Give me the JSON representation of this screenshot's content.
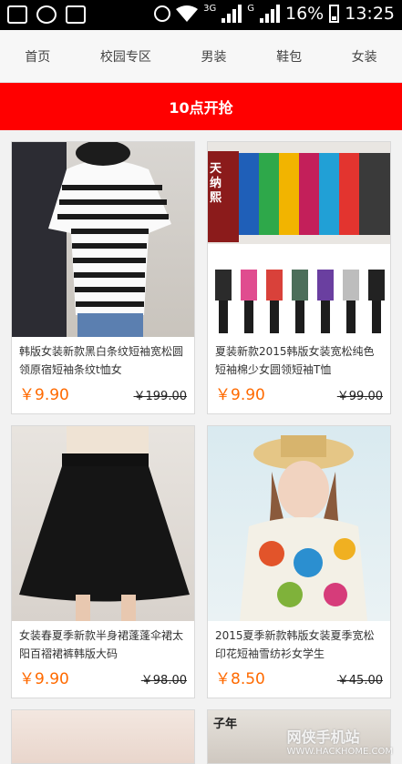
{
  "status_bar": {
    "battery": "16%",
    "time": "13:25",
    "network_3g": "3G",
    "network_g": "G",
    "icons": [
      "image-icon",
      "data-sync-icon",
      "message-icon",
      "alarm-icon",
      "wifi-icon",
      "signal-icon",
      "battery-icon"
    ]
  },
  "nav": {
    "tabs": [
      {
        "label": "首页"
      },
      {
        "label": "校园专区"
      },
      {
        "label": "男装"
      },
      {
        "label": "鞋包"
      },
      {
        "label": "女装"
      }
    ]
  },
  "banner": {
    "label": "10点开抢"
  },
  "products": [
    {
      "title": "韩版女装新款黑白条纹短袖宽松圆领原宿短袖条纹t恤女",
      "price": "￥9.90",
      "original_price": "￥199.00"
    },
    {
      "title": "夏装新款2015韩版女装宽松纯色短袖棉少女圆领短袖T恤",
      "price": "￥9.90",
      "original_price": "￥99.00",
      "image_text": "天纳熙"
    },
    {
      "title": "女装春夏季新款半身裙蓬蓬伞裙太阳百褶裙裤韩版大码",
      "price": "￥9.90",
      "original_price": "￥98.00"
    },
    {
      "title": "2015夏季新款韩版女装夏季宽松印花短袖雪纺衫女学生",
      "price": "￥8.50",
      "original_price": "￥45.00"
    }
  ],
  "partial_card_text": "子年",
  "watermark": {
    "main": "网侠手机站",
    "sub": "WWW.HACKHOME.COM"
  },
  "colors": {
    "banner": "#ff0000",
    "price": "#ff6a00"
  }
}
